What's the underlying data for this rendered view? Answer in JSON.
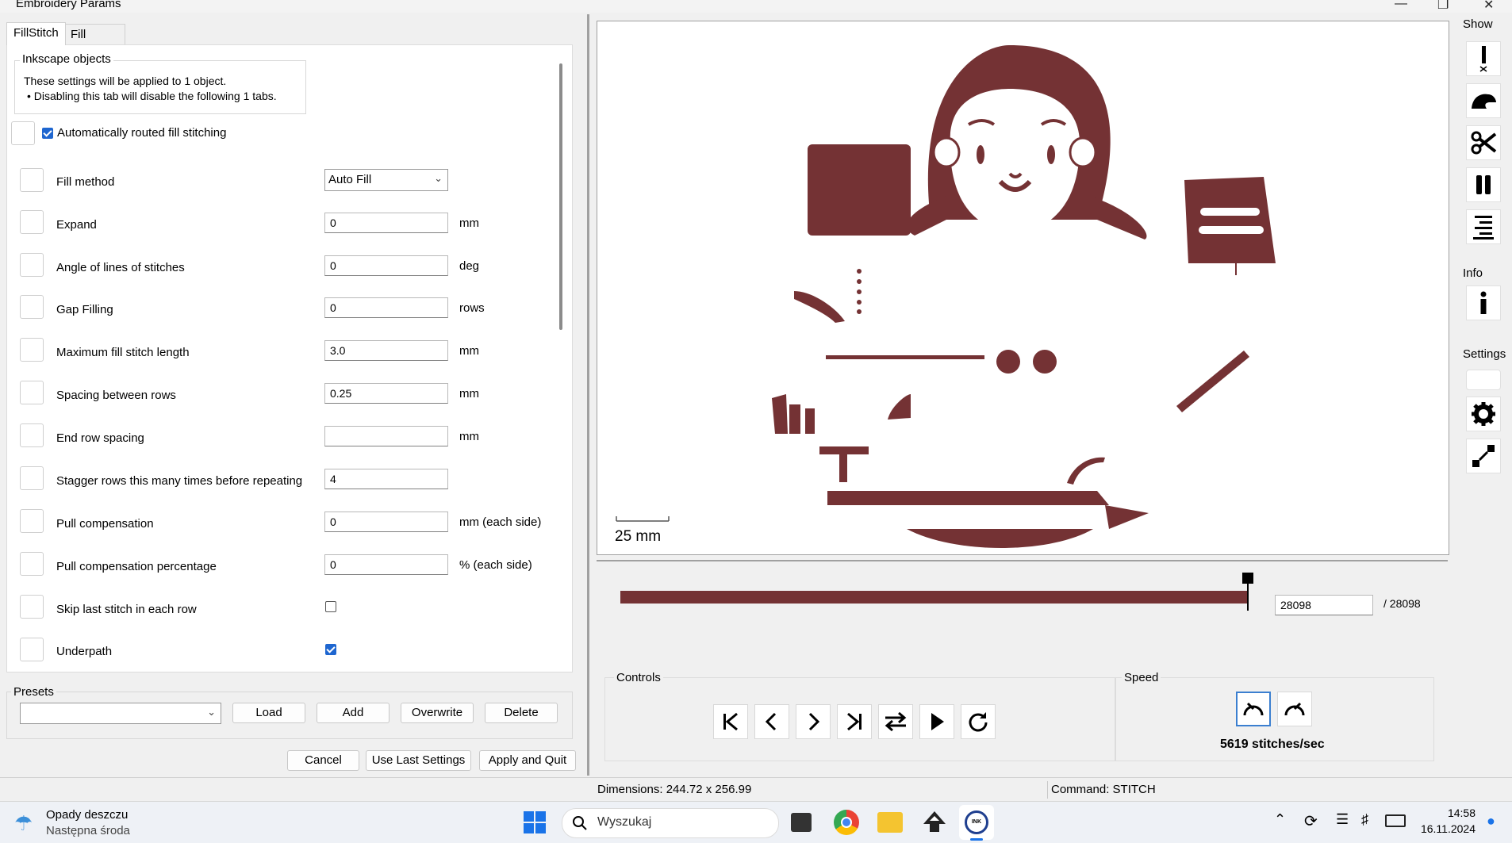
{
  "window": {
    "title": "Embroidery Params"
  },
  "tabs": [
    {
      "label": "FillStitch"
    },
    {
      "label": "Fill Underlay"
    }
  ],
  "inkscape_objects": {
    "legend": "Inkscape objects",
    "line1": "These settings will be applied to 1 object.",
    "line2": "• Disabling this tab will disable the following 1 tabs."
  },
  "auto_route": {
    "label": "Automatically routed fill stitching",
    "checked": true
  },
  "params": [
    {
      "label": "Fill method",
      "value": "Auto Fill",
      "unit": "",
      "kind": "select"
    },
    {
      "label": "Expand",
      "value": "0",
      "unit": "mm",
      "kind": "text"
    },
    {
      "label": "Angle of lines of stitches",
      "value": "0",
      "unit": "deg",
      "kind": "text"
    },
    {
      "label": "Gap Filling",
      "value": "0",
      "unit": "rows",
      "kind": "text"
    },
    {
      "label": "Maximum fill stitch length",
      "value": "3.0",
      "unit": "mm",
      "kind": "text"
    },
    {
      "label": "Spacing between rows",
      "value": "0.25",
      "unit": "mm",
      "kind": "text"
    },
    {
      "label": "End row spacing",
      "value": "",
      "unit": "mm",
      "kind": "text"
    },
    {
      "label": "Stagger rows this many times before repeating",
      "value": "4",
      "unit": "",
      "kind": "text"
    },
    {
      "label": "Pull compensation",
      "value": "0",
      "unit": "mm (each side)",
      "kind": "text"
    },
    {
      "label": "Pull compensation percentage",
      "value": "0",
      "unit": "% (each side)",
      "kind": "text"
    },
    {
      "label": "Skip last stitch in each row",
      "value": "",
      "unit": "",
      "kind": "checkbox",
      "checked": false
    },
    {
      "label": "Underpath",
      "value": "",
      "unit": "",
      "kind": "checkbox",
      "checked": true
    }
  ],
  "presets": {
    "legend": "Presets",
    "selected": "",
    "load": "Load",
    "add": "Add",
    "overwrite": "Overwrite",
    "delete": "Delete"
  },
  "footer": {
    "cancel": "Cancel",
    "use_last": "Use Last Settings",
    "apply": "Apply and Quit"
  },
  "preview": {
    "scale_label": "25 mm",
    "design_color": "#743234"
  },
  "timeline": {
    "current": "28098",
    "total": "/ 28098",
    "progress": 1.0
  },
  "controls": {
    "legend": "Controls"
  },
  "speed": {
    "legend": "Speed",
    "value": "5619 stitches/sec"
  },
  "sidebar": {
    "show": "Show",
    "info": "Info",
    "settings": "Settings"
  },
  "status": {
    "dimensions": "Dimensions: 244.72 x 256.99",
    "command": "Command: STITCH"
  },
  "taskbar": {
    "weather_title": "Opady deszczu",
    "weather_sub": "Następna środa",
    "search_placeholder": "Wyszukaj",
    "time": "14:58",
    "date": "16.11.2024"
  }
}
